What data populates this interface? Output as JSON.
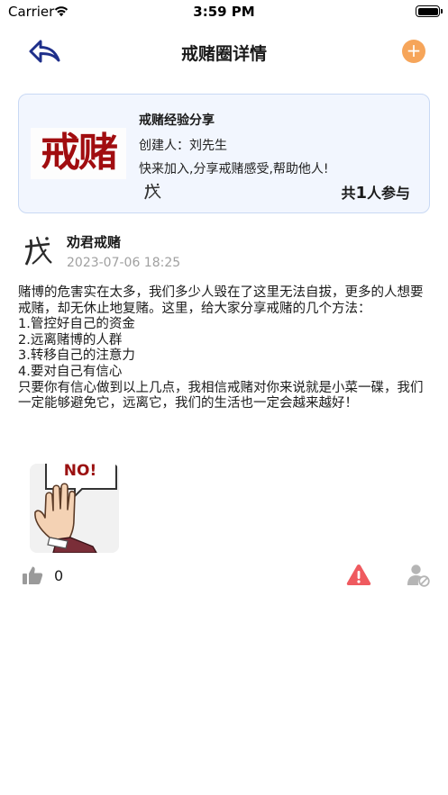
{
  "status_bar": {
    "carrier": "Carrier",
    "time": "3:59 PM"
  },
  "nav": {
    "title": "戒赌圈详情",
    "back_icon": "back-arrow-icon",
    "add_icon": "plus-icon",
    "add_label": "+",
    "accent_color": "#f6a55a"
  },
  "circle": {
    "logo_text": "戒赌",
    "name": "戒赌经验分享",
    "creator": "创建人：刘先生",
    "description": "快来加入,分享戒赌感受,帮助他人!",
    "member_prefix": "共",
    "member_count": "1",
    "member_suffix": "人参与",
    "logo_color": "#a10d10"
  },
  "post": {
    "author": "劝君戒赌",
    "timestamp": "2023-07-06 18:25",
    "body": "赌博的危害实在太多，我们多少人毁在了这里无法自拔，更多的人想要戒赌，却无休止地复赌。这里，给大家分享戒赌的几个方法：\n1.管控好自己的资金\n2.远离赌博的人群\n3.转移自己的注意力\n4.要对自己有信心\n只要你有信心做到以上几点，我相信戒赌对你来说就是小菜一碟，我们一定能够避免它，远离它，我们的生活也一定会越来越好！",
    "image_sign_text": "NO!",
    "like_count": "0",
    "like_icon": "thumbs-up-icon",
    "report_icon": "warning-icon",
    "block_icon": "block-user-icon",
    "report_color": "#ef5a5f"
  }
}
